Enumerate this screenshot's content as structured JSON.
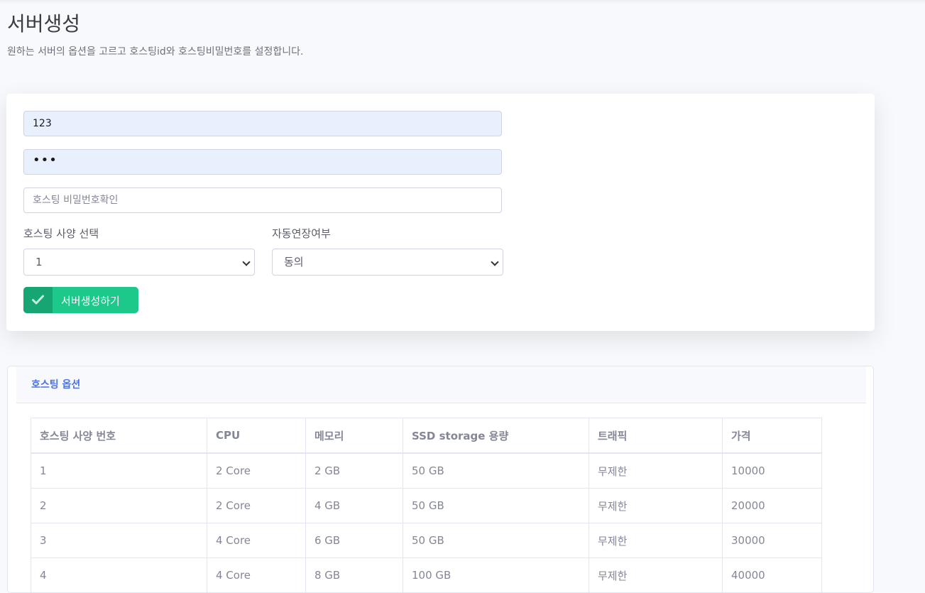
{
  "header": {
    "title": "서버생성",
    "description": "원하는 서버의 옵션을 고르고 호스팅id와 호스팅비밀번호를 설정합니다."
  },
  "form": {
    "hosting_id_value": "123",
    "password_value": "•••",
    "password_confirm_placeholder": "호스팅 비밀번호확인",
    "spec_label": "호스팅 사양 선택",
    "spec_selected": "1",
    "renew_label": "자동연장여부",
    "renew_selected": "동의",
    "submit_label": "서버생성하기"
  },
  "options_card": {
    "title": "호스팅 옵션",
    "columns": [
      "호스팅 사양 번호",
      "CPU",
      "메모리",
      "SSD storage 용량",
      "트래픽",
      "가격"
    ],
    "rows": [
      [
        "1",
        "2 Core",
        "2 GB",
        "50 GB",
        "무제한",
        "10000"
      ],
      [
        "2",
        "2 Core",
        "4 GB",
        "50 GB",
        "무제한",
        "20000"
      ],
      [
        "3",
        "4 Core",
        "6 GB",
        "50 GB",
        "무제한",
        "30000"
      ],
      [
        "4",
        "4 Core",
        "8 GB",
        "100 GB",
        "무제한",
        "40000"
      ]
    ]
  },
  "colors": {
    "primary": "#4e73df",
    "success": "#1cc88a",
    "success_dark": "#17a673",
    "autofill_bg": "#e8f0fe"
  }
}
